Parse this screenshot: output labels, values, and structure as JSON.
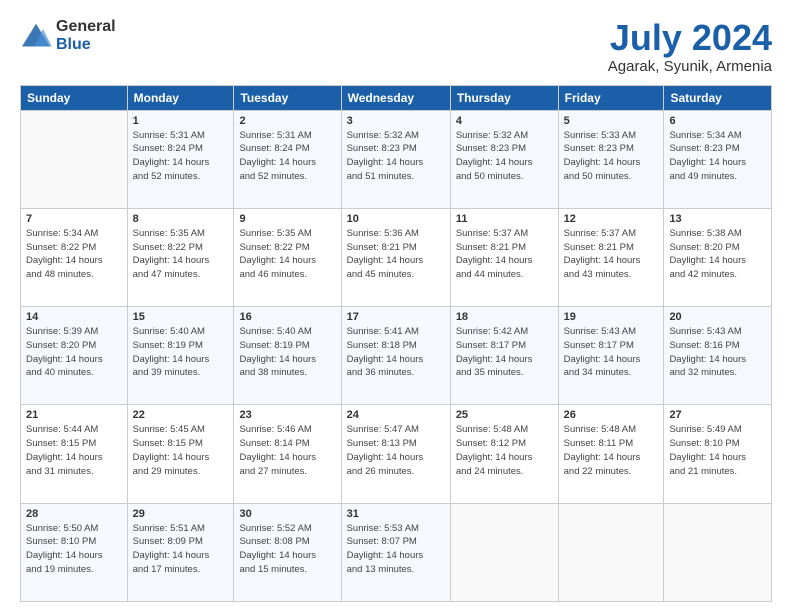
{
  "logo": {
    "general": "General",
    "blue": "Blue"
  },
  "header": {
    "title": "July 2024",
    "subtitle": "Agarak, Syunik, Armenia"
  },
  "calendar": {
    "days_of_week": [
      "Sunday",
      "Monday",
      "Tuesday",
      "Wednesday",
      "Thursday",
      "Friday",
      "Saturday"
    ],
    "weeks": [
      [
        {
          "day": "",
          "info": ""
        },
        {
          "day": "1",
          "info": "Sunrise: 5:31 AM\nSunset: 8:24 PM\nDaylight: 14 hours\nand 52 minutes."
        },
        {
          "day": "2",
          "info": "Sunrise: 5:31 AM\nSunset: 8:24 PM\nDaylight: 14 hours\nand 52 minutes."
        },
        {
          "day": "3",
          "info": "Sunrise: 5:32 AM\nSunset: 8:23 PM\nDaylight: 14 hours\nand 51 minutes."
        },
        {
          "day": "4",
          "info": "Sunrise: 5:32 AM\nSunset: 8:23 PM\nDaylight: 14 hours\nand 50 minutes."
        },
        {
          "day": "5",
          "info": "Sunrise: 5:33 AM\nSunset: 8:23 PM\nDaylight: 14 hours\nand 50 minutes."
        },
        {
          "day": "6",
          "info": "Sunrise: 5:34 AM\nSunset: 8:23 PM\nDaylight: 14 hours\nand 49 minutes."
        }
      ],
      [
        {
          "day": "7",
          "info": "Sunrise: 5:34 AM\nSunset: 8:22 PM\nDaylight: 14 hours\nand 48 minutes."
        },
        {
          "day": "8",
          "info": "Sunrise: 5:35 AM\nSunset: 8:22 PM\nDaylight: 14 hours\nand 47 minutes."
        },
        {
          "day": "9",
          "info": "Sunrise: 5:35 AM\nSunset: 8:22 PM\nDaylight: 14 hours\nand 46 minutes."
        },
        {
          "day": "10",
          "info": "Sunrise: 5:36 AM\nSunset: 8:21 PM\nDaylight: 14 hours\nand 45 minutes."
        },
        {
          "day": "11",
          "info": "Sunrise: 5:37 AM\nSunset: 8:21 PM\nDaylight: 14 hours\nand 44 minutes."
        },
        {
          "day": "12",
          "info": "Sunrise: 5:37 AM\nSunset: 8:21 PM\nDaylight: 14 hours\nand 43 minutes."
        },
        {
          "day": "13",
          "info": "Sunrise: 5:38 AM\nSunset: 8:20 PM\nDaylight: 14 hours\nand 42 minutes."
        }
      ],
      [
        {
          "day": "14",
          "info": "Sunrise: 5:39 AM\nSunset: 8:20 PM\nDaylight: 14 hours\nand 40 minutes."
        },
        {
          "day": "15",
          "info": "Sunrise: 5:40 AM\nSunset: 8:19 PM\nDaylight: 14 hours\nand 39 minutes."
        },
        {
          "day": "16",
          "info": "Sunrise: 5:40 AM\nSunset: 8:19 PM\nDaylight: 14 hours\nand 38 minutes."
        },
        {
          "day": "17",
          "info": "Sunrise: 5:41 AM\nSunset: 8:18 PM\nDaylight: 14 hours\nand 36 minutes."
        },
        {
          "day": "18",
          "info": "Sunrise: 5:42 AM\nSunset: 8:17 PM\nDaylight: 14 hours\nand 35 minutes."
        },
        {
          "day": "19",
          "info": "Sunrise: 5:43 AM\nSunset: 8:17 PM\nDaylight: 14 hours\nand 34 minutes."
        },
        {
          "day": "20",
          "info": "Sunrise: 5:43 AM\nSunset: 8:16 PM\nDaylight: 14 hours\nand 32 minutes."
        }
      ],
      [
        {
          "day": "21",
          "info": "Sunrise: 5:44 AM\nSunset: 8:15 PM\nDaylight: 14 hours\nand 31 minutes."
        },
        {
          "day": "22",
          "info": "Sunrise: 5:45 AM\nSunset: 8:15 PM\nDaylight: 14 hours\nand 29 minutes."
        },
        {
          "day": "23",
          "info": "Sunrise: 5:46 AM\nSunset: 8:14 PM\nDaylight: 14 hours\nand 27 minutes."
        },
        {
          "day": "24",
          "info": "Sunrise: 5:47 AM\nSunset: 8:13 PM\nDaylight: 14 hours\nand 26 minutes."
        },
        {
          "day": "25",
          "info": "Sunrise: 5:48 AM\nSunset: 8:12 PM\nDaylight: 14 hours\nand 24 minutes."
        },
        {
          "day": "26",
          "info": "Sunrise: 5:48 AM\nSunset: 8:11 PM\nDaylight: 14 hours\nand 22 minutes."
        },
        {
          "day": "27",
          "info": "Sunrise: 5:49 AM\nSunset: 8:10 PM\nDaylight: 14 hours\nand 21 minutes."
        }
      ],
      [
        {
          "day": "28",
          "info": "Sunrise: 5:50 AM\nSunset: 8:10 PM\nDaylight: 14 hours\nand 19 minutes."
        },
        {
          "day": "29",
          "info": "Sunrise: 5:51 AM\nSunset: 8:09 PM\nDaylight: 14 hours\nand 17 minutes."
        },
        {
          "day": "30",
          "info": "Sunrise: 5:52 AM\nSunset: 8:08 PM\nDaylight: 14 hours\nand 15 minutes."
        },
        {
          "day": "31",
          "info": "Sunrise: 5:53 AM\nSunset: 8:07 PM\nDaylight: 14 hours\nand 13 minutes."
        },
        {
          "day": "",
          "info": ""
        },
        {
          "day": "",
          "info": ""
        },
        {
          "day": "",
          "info": ""
        }
      ]
    ]
  }
}
